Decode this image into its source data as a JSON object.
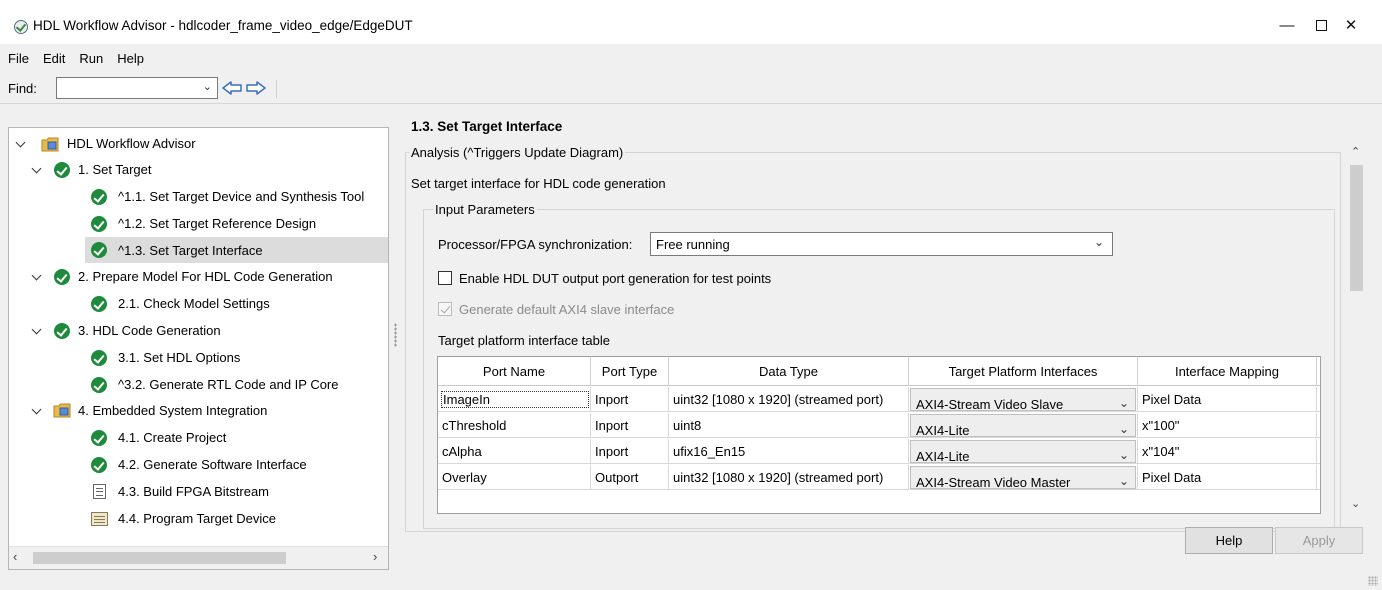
{
  "window": {
    "title": "HDL Workflow Advisor - hdlcoder_frame_video_edge/EdgeDUT",
    "minimize_glyph": "—",
    "close_glyph": "✕"
  },
  "menu": [
    "File",
    "Edit",
    "Run",
    "Help"
  ],
  "toolbar": {
    "find_label": "Find:",
    "find_value": "",
    "back_icon": "back-arrow-icon",
    "forward_icon": "forward-arrow-icon"
  },
  "tree": {
    "items": [
      {
        "label": "HDL Workflow Advisor",
        "icon": "advisor-folder-icon"
      },
      {
        "label": "1. Set Target",
        "icon": "check-icon"
      },
      {
        "label": "^1.1. Set Target Device and Synthesis Tool",
        "icon": "check-icon"
      },
      {
        "label": "^1.2. Set Target Reference Design",
        "icon": "check-icon"
      },
      {
        "label": "^1.3. Set Target Interface",
        "icon": "check-icon",
        "selected": true
      },
      {
        "label": "2. Prepare Model For HDL Code Generation",
        "icon": "check-icon"
      },
      {
        "label": "2.1. Check Model Settings",
        "icon": "check-icon"
      },
      {
        "label": "3. HDL Code Generation",
        "icon": "check-icon"
      },
      {
        "label": "3.1. Set HDL Options",
        "icon": "check-icon"
      },
      {
        "label": "^3.2. Generate RTL Code and IP Core",
        "icon": "check-icon"
      },
      {
        "label": "4. Embedded System Integration",
        "icon": "advisor-folder-icon"
      },
      {
        "label": "4.1. Create Project",
        "icon": "check-icon"
      },
      {
        "label": "4.2. Generate Software Interface",
        "icon": "check-icon"
      },
      {
        "label": "4.3. Build FPGA Bitstream",
        "icon": "document-icon"
      },
      {
        "label": "4.4. Program Target Device",
        "icon": "program-icon"
      }
    ]
  },
  "content": {
    "section_title": "1.3. Set Target Interface",
    "analysis_legend": "Analysis (^Triggers Update Diagram)",
    "description": "Set target interface for HDL code generation",
    "input_params_legend": "Input Parameters",
    "sync_label": "Processor/FPGA synchronization:",
    "sync_value": "Free running",
    "enable_test_points_label": "Enable HDL DUT output port generation for test points",
    "generate_axi4_label": "Generate default AXI4 slave interface",
    "table_caption": "Target platform interface table",
    "table": {
      "headers": [
        "Port Name",
        "Port Type",
        "Data Type",
        "Target Platform Interfaces",
        "Interface Mapping"
      ],
      "rows": [
        {
          "port": "ImageIn",
          "type": "Inport",
          "dtype": "uint32 [1080 x 1920] (streamed port)",
          "iface": "AXI4-Stream Video Slave",
          "mapping": "Pixel Data"
        },
        {
          "port": "cThreshold",
          "type": "Inport",
          "dtype": "uint8",
          "iface": "AXI4-Lite",
          "mapping": "x\"100\""
        },
        {
          "port": "cAlpha",
          "type": "Inport",
          "dtype": "ufix16_En15",
          "iface": "AXI4-Lite",
          "mapping": "x\"104\""
        },
        {
          "port": "Overlay",
          "type": "Outport",
          "dtype": "uint32 [1080 x 1920] (streamed port)",
          "iface": "AXI4-Stream Video Master",
          "mapping": "Pixel Data"
        }
      ]
    }
  },
  "buttons": {
    "help": "Help",
    "apply": "Apply"
  }
}
